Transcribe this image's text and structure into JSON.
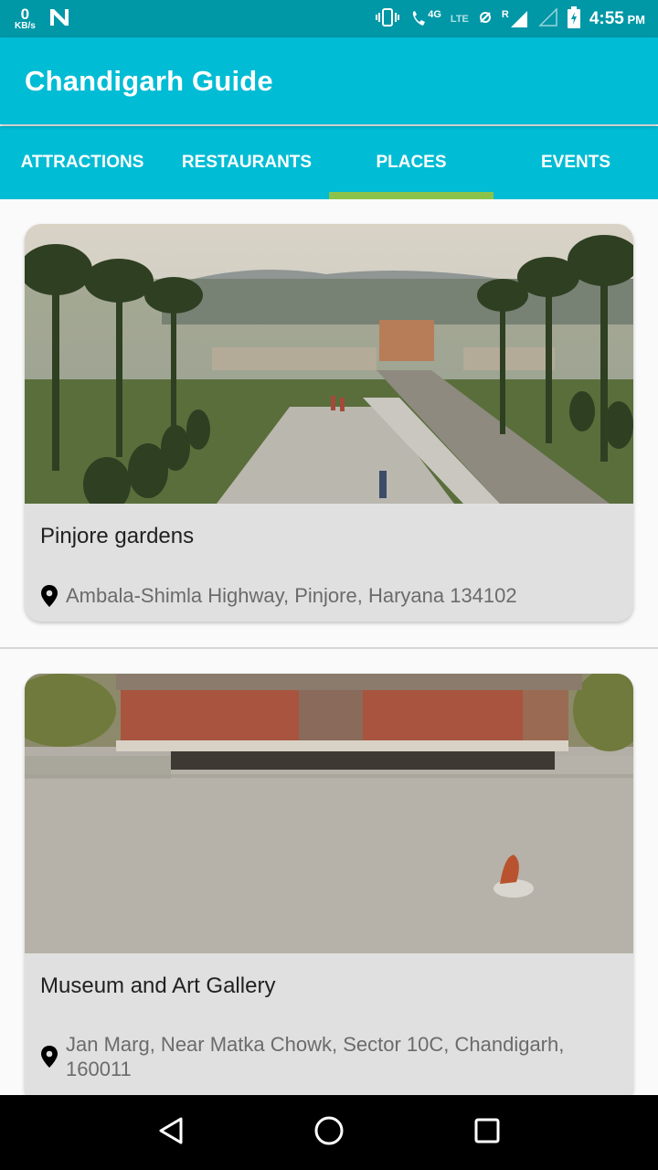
{
  "status_bar": {
    "speed_value": "0",
    "speed_unit": "KB/s",
    "network_4g": "4G",
    "network_lte": "LTE",
    "roaming": "R",
    "time": "4:55",
    "ampm": "PM"
  },
  "app": {
    "title": "Chandigarh Guide"
  },
  "tabs": [
    {
      "label": "ATTRACTIONS",
      "active": false
    },
    {
      "label": "RESTAURANTS",
      "active": false
    },
    {
      "label": "PLACES",
      "active": true
    },
    {
      "label": "EVENTS",
      "active": false
    }
  ],
  "places": [
    {
      "name": "Pinjore gardens",
      "address": "Ambala-Shimla Highway, Pinjore, Haryana 134102"
    },
    {
      "name": "Museum and Art Gallery",
      "address": "Jan Marg, Near Matka Chowk, Sector 10C, Chandigarh, 160011"
    }
  ],
  "colors": {
    "primary": "#00bcd4",
    "status_bar": "#0097a7",
    "tab_indicator": "#8bc34a",
    "card_bg": "#e0e0e0"
  },
  "icons": {
    "location": "location-pin-icon",
    "back": "nav-back-icon",
    "home": "nav-home-icon",
    "recents": "nav-recents-icon"
  }
}
